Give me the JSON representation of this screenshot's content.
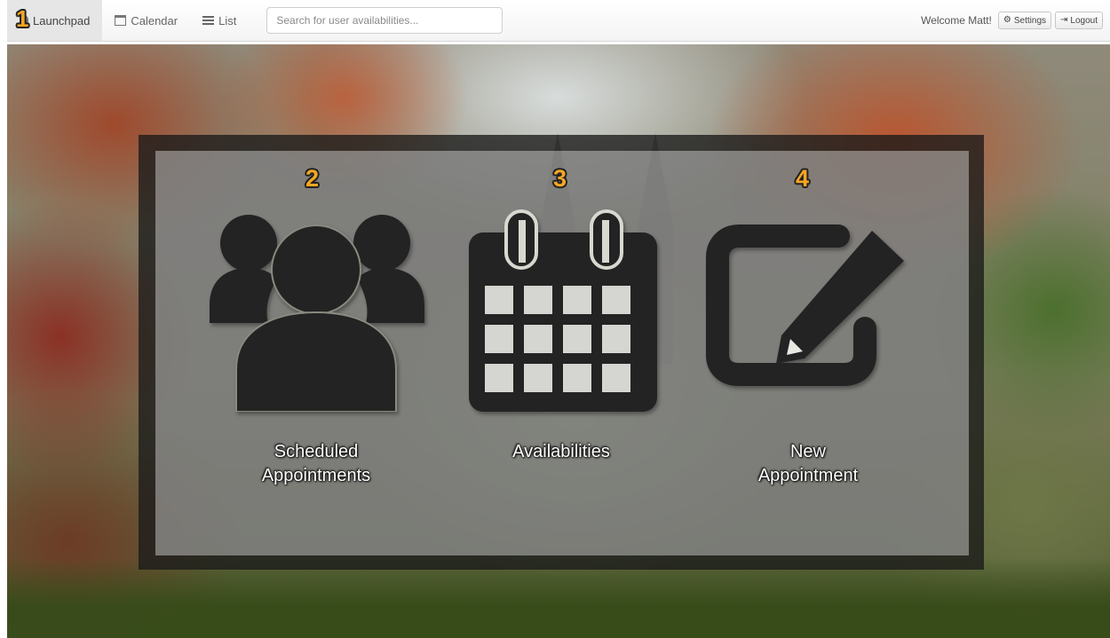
{
  "navbar": {
    "items": [
      {
        "label": "Launchpad",
        "icon": "rocket-icon",
        "active": true
      },
      {
        "label": "Calendar",
        "icon": "calendar-icon",
        "active": false
      },
      {
        "label": "List",
        "icon": "list-icon",
        "active": false
      }
    ],
    "search_placeholder": "Search for user availabilities...",
    "welcome": "Welcome Matt!",
    "settings_label": "Settings",
    "logout_label": "Logout"
  },
  "launchpad": {
    "tiles": [
      {
        "label_line1": "Scheduled",
        "label_line2": "Appointments",
        "badge": "2",
        "icon": "users-icon"
      },
      {
        "label_line1": "Availabilities",
        "label_line2": "",
        "badge": "3",
        "icon": "calendar-icon"
      },
      {
        "label_line1": "New",
        "label_line2": "Appointment",
        "badge": "4",
        "icon": "edit-icon"
      }
    ],
    "nav_badge": "1"
  },
  "colors": {
    "badge": "#f5a623",
    "icon": "#232323",
    "frame": "#191919"
  }
}
